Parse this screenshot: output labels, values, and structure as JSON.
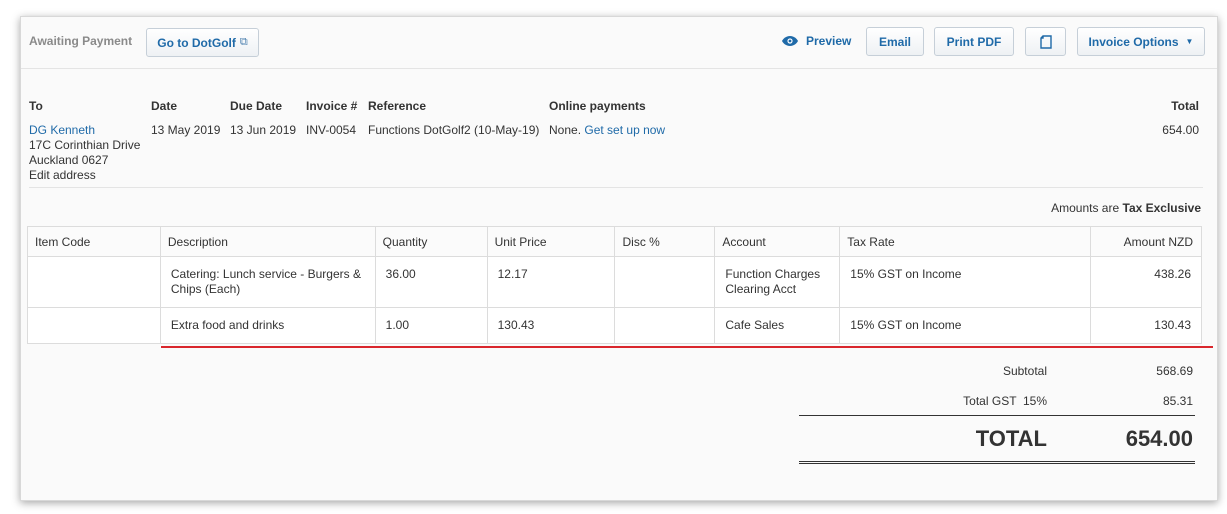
{
  "toolbar": {
    "status": "Awaiting Payment",
    "goto_label": "Go to DotGolf",
    "preview_label": "Preview",
    "email_label": "Email",
    "print_label": "Print PDF",
    "options_label": "Invoice Options"
  },
  "invoice": {
    "headers": {
      "to": "To",
      "date": "Date",
      "due_date": "Due Date",
      "invoice_no": "Invoice #",
      "reference": "Reference",
      "online_payments": "Online payments",
      "total": "Total"
    },
    "contact_name": "DG Kenneth",
    "address_line1": "17C Corinthian Drive",
    "address_line2": "Auckland 0627",
    "edit_address": "Edit address",
    "date": "13 May 2019",
    "due_date": "13 Jun 2019",
    "invoice_no": "INV-0054",
    "reference": "Functions DotGolf2 (10-May-19)",
    "online_payments_status": "None.",
    "online_payments_link": "Get set up now",
    "total": "654.00"
  },
  "tax_note": {
    "prefix": "Amounts are",
    "mode": "Tax Exclusive"
  },
  "table": {
    "columns": [
      "Item Code",
      "Description",
      "Quantity",
      "Unit Price",
      "Disc %",
      "Account",
      "Tax Rate",
      "Amount NZD"
    ],
    "rows": [
      {
        "item_code": "",
        "description": "Catering: Lunch service - Burgers & Chips (Each)",
        "quantity": "36.00",
        "unit_price": "12.17",
        "disc": "",
        "account": "Function Charges Clearing Acct",
        "tax_rate": "15% GST on Income",
        "amount": "438.26"
      },
      {
        "item_code": "",
        "description": "Extra food and drinks",
        "quantity": "1.00",
        "unit_price": "130.43",
        "disc": "",
        "account": "Cafe Sales",
        "tax_rate": "15% GST on Income",
        "amount": "130.43"
      }
    ]
  },
  "summary": {
    "subtotal_label": "Subtotal",
    "subtotal": "568.69",
    "gst_label": "Total GST  15%",
    "gst": "85.31",
    "total_label": "TOTAL",
    "total": "654.00"
  },
  "colors": {
    "link": "#1f6aa8",
    "highlight_line": "#d9262c"
  }
}
